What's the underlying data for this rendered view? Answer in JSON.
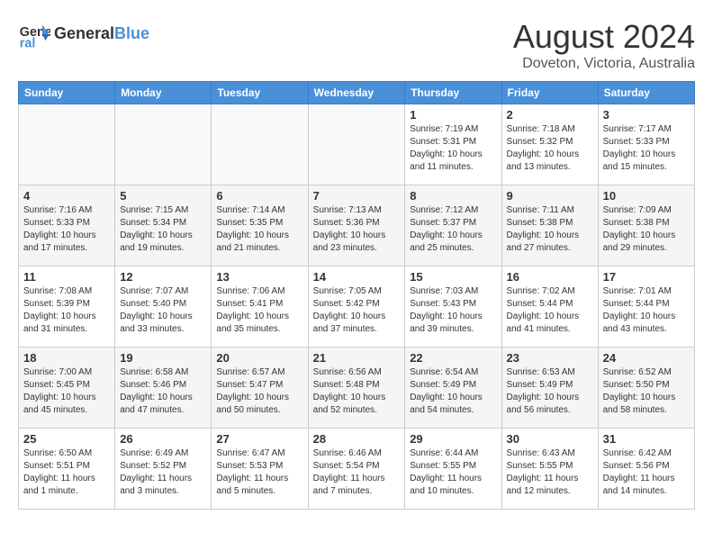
{
  "header": {
    "logo_line1": "General",
    "logo_line2": "Blue",
    "month_title": "August 2024",
    "subtitle": "Doveton, Victoria, Australia"
  },
  "weekdays": [
    "Sunday",
    "Monday",
    "Tuesday",
    "Wednesday",
    "Thursday",
    "Friday",
    "Saturday"
  ],
  "weeks": [
    [
      {
        "day": "",
        "info": ""
      },
      {
        "day": "",
        "info": ""
      },
      {
        "day": "",
        "info": ""
      },
      {
        "day": "",
        "info": ""
      },
      {
        "day": "1",
        "info": "Sunrise: 7:19 AM\nSunset: 5:31 PM\nDaylight: 10 hours\nand 11 minutes."
      },
      {
        "day": "2",
        "info": "Sunrise: 7:18 AM\nSunset: 5:32 PM\nDaylight: 10 hours\nand 13 minutes."
      },
      {
        "day": "3",
        "info": "Sunrise: 7:17 AM\nSunset: 5:33 PM\nDaylight: 10 hours\nand 15 minutes."
      }
    ],
    [
      {
        "day": "4",
        "info": "Sunrise: 7:16 AM\nSunset: 5:33 PM\nDaylight: 10 hours\nand 17 minutes."
      },
      {
        "day": "5",
        "info": "Sunrise: 7:15 AM\nSunset: 5:34 PM\nDaylight: 10 hours\nand 19 minutes."
      },
      {
        "day": "6",
        "info": "Sunrise: 7:14 AM\nSunset: 5:35 PM\nDaylight: 10 hours\nand 21 minutes."
      },
      {
        "day": "7",
        "info": "Sunrise: 7:13 AM\nSunset: 5:36 PM\nDaylight: 10 hours\nand 23 minutes."
      },
      {
        "day": "8",
        "info": "Sunrise: 7:12 AM\nSunset: 5:37 PM\nDaylight: 10 hours\nand 25 minutes."
      },
      {
        "day": "9",
        "info": "Sunrise: 7:11 AM\nSunset: 5:38 PM\nDaylight: 10 hours\nand 27 minutes."
      },
      {
        "day": "10",
        "info": "Sunrise: 7:09 AM\nSunset: 5:38 PM\nDaylight: 10 hours\nand 29 minutes."
      }
    ],
    [
      {
        "day": "11",
        "info": "Sunrise: 7:08 AM\nSunset: 5:39 PM\nDaylight: 10 hours\nand 31 minutes."
      },
      {
        "day": "12",
        "info": "Sunrise: 7:07 AM\nSunset: 5:40 PM\nDaylight: 10 hours\nand 33 minutes."
      },
      {
        "day": "13",
        "info": "Sunrise: 7:06 AM\nSunset: 5:41 PM\nDaylight: 10 hours\nand 35 minutes."
      },
      {
        "day": "14",
        "info": "Sunrise: 7:05 AM\nSunset: 5:42 PM\nDaylight: 10 hours\nand 37 minutes."
      },
      {
        "day": "15",
        "info": "Sunrise: 7:03 AM\nSunset: 5:43 PM\nDaylight: 10 hours\nand 39 minutes."
      },
      {
        "day": "16",
        "info": "Sunrise: 7:02 AM\nSunset: 5:44 PM\nDaylight: 10 hours\nand 41 minutes."
      },
      {
        "day": "17",
        "info": "Sunrise: 7:01 AM\nSunset: 5:44 PM\nDaylight: 10 hours\nand 43 minutes."
      }
    ],
    [
      {
        "day": "18",
        "info": "Sunrise: 7:00 AM\nSunset: 5:45 PM\nDaylight: 10 hours\nand 45 minutes."
      },
      {
        "day": "19",
        "info": "Sunrise: 6:58 AM\nSunset: 5:46 PM\nDaylight: 10 hours\nand 47 minutes."
      },
      {
        "day": "20",
        "info": "Sunrise: 6:57 AM\nSunset: 5:47 PM\nDaylight: 10 hours\nand 50 minutes."
      },
      {
        "day": "21",
        "info": "Sunrise: 6:56 AM\nSunset: 5:48 PM\nDaylight: 10 hours\nand 52 minutes."
      },
      {
        "day": "22",
        "info": "Sunrise: 6:54 AM\nSunset: 5:49 PM\nDaylight: 10 hours\nand 54 minutes."
      },
      {
        "day": "23",
        "info": "Sunrise: 6:53 AM\nSunset: 5:49 PM\nDaylight: 10 hours\nand 56 minutes."
      },
      {
        "day": "24",
        "info": "Sunrise: 6:52 AM\nSunset: 5:50 PM\nDaylight: 10 hours\nand 58 minutes."
      }
    ],
    [
      {
        "day": "25",
        "info": "Sunrise: 6:50 AM\nSunset: 5:51 PM\nDaylight: 11 hours\nand 1 minute."
      },
      {
        "day": "26",
        "info": "Sunrise: 6:49 AM\nSunset: 5:52 PM\nDaylight: 11 hours\nand 3 minutes."
      },
      {
        "day": "27",
        "info": "Sunrise: 6:47 AM\nSunset: 5:53 PM\nDaylight: 11 hours\nand 5 minutes."
      },
      {
        "day": "28",
        "info": "Sunrise: 6:46 AM\nSunset: 5:54 PM\nDaylight: 11 hours\nand 7 minutes."
      },
      {
        "day": "29",
        "info": "Sunrise: 6:44 AM\nSunset: 5:55 PM\nDaylight: 11 hours\nand 10 minutes."
      },
      {
        "day": "30",
        "info": "Sunrise: 6:43 AM\nSunset: 5:55 PM\nDaylight: 11 hours\nand 12 minutes."
      },
      {
        "day": "31",
        "info": "Sunrise: 6:42 AM\nSunset: 5:56 PM\nDaylight: 11 hours\nand 14 minutes."
      }
    ]
  ]
}
